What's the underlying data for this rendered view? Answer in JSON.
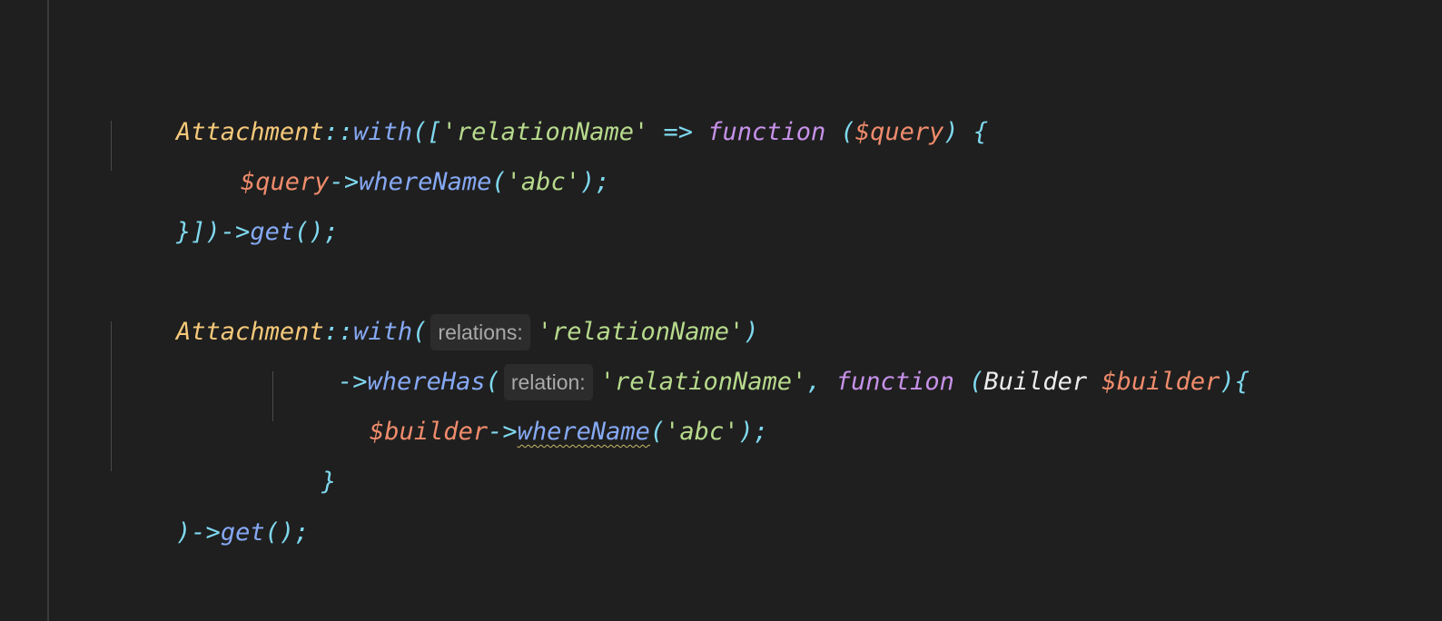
{
  "code": {
    "line1": {
      "class_name": "Attachment",
      "scope_op": "::",
      "method": "with",
      "open": "([",
      "arg": "'relationName'",
      "arrow": " => ",
      "keyword": "function",
      "paren_open": " (",
      "param": "$query",
      "paren_close": ") {"
    },
    "line2": {
      "var": "$query",
      "arrow": "->",
      "method": "whereName",
      "open": "(",
      "arg": "'abc'",
      "close": ");"
    },
    "line3": {
      "close": "}])->",
      "method": "get",
      "end": "();"
    },
    "line4": {
      "class_name": "Attachment",
      "scope_op": "::",
      "method": "with",
      "open": "(",
      "hint": "relations:",
      "arg": "'relationName'",
      "close": ")"
    },
    "line5": {
      "arrow": "->",
      "method": "whereHas",
      "open": "(",
      "hint": "relation:",
      "arg": "'relationName'",
      "comma": ", ",
      "keyword": "function",
      "paren_open": " (",
      "type": "Builder",
      "param": " $builder",
      "paren_close": "){"
    },
    "line6": {
      "var": "$builder",
      "arrow": "->",
      "method": "whereName",
      "open": "(",
      "arg": "'abc'",
      "close": ");"
    },
    "line7": {
      "close": "}"
    },
    "line8": {
      "close": ")->",
      "method": "get",
      "end": "();"
    }
  },
  "colors": {
    "background": "#1f1f1f",
    "class": "#f5c97a",
    "operator": "#7fd8ee",
    "method": "#86a9f4",
    "string": "#b7da8c",
    "keyword": "#c792ea",
    "variable": "#f08c6c",
    "type": "#ececec"
  }
}
